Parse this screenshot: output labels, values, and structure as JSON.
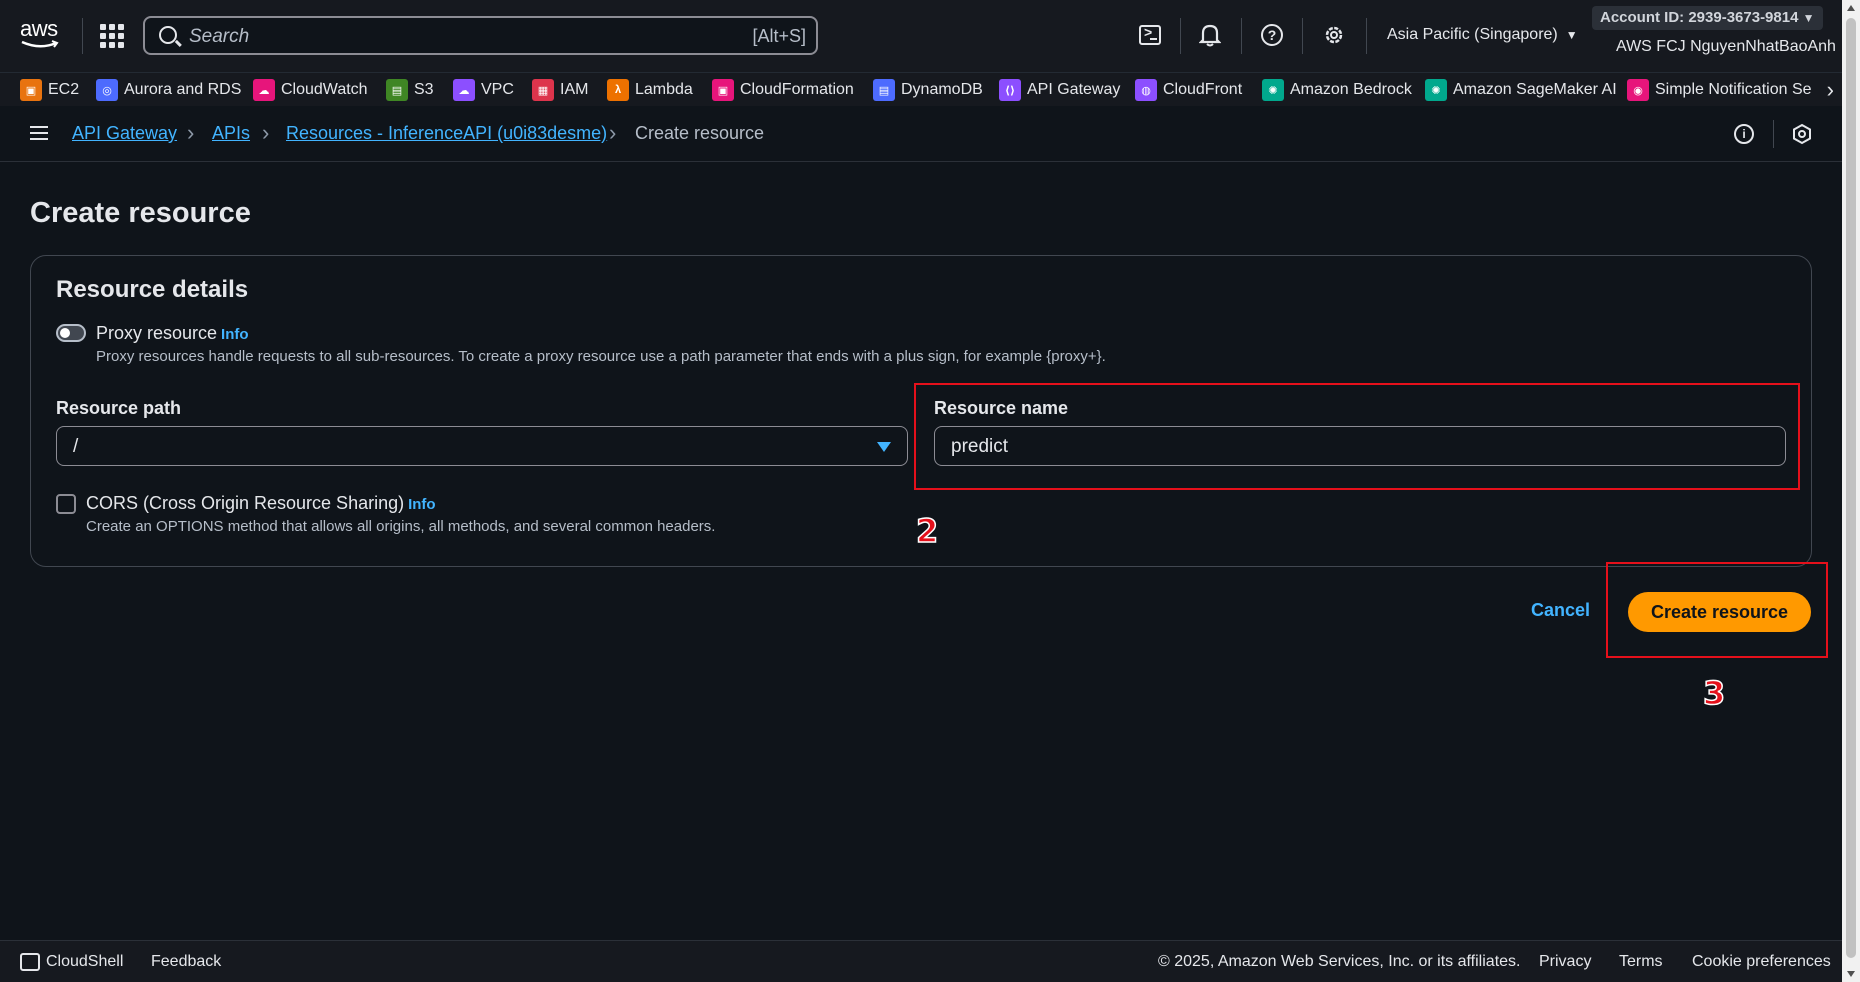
{
  "topbar": {
    "logo_text": "aws",
    "search_placeholder": "Search",
    "search_shortcut": "[Alt+S]",
    "region": "Asia Pacific (Singapore)",
    "account_id": "Account ID: 2939-3673-9814",
    "account_user": "AWS FCJ NguyenNhatBaoAnh"
  },
  "favorites": [
    {
      "label": "EC2",
      "color": "#e8730f"
    },
    {
      "label": "Aurora and RDS",
      "color": "#4d6bfe"
    },
    {
      "label": "CloudWatch",
      "color": "#e7157b"
    },
    {
      "label": "S3",
      "color": "#3f8624"
    },
    {
      "label": "VPC",
      "color": "#8c4fff"
    },
    {
      "label": "IAM",
      "color": "#dd344c"
    },
    {
      "label": "Lambda",
      "color": "#ed7100"
    },
    {
      "label": "CloudFormation",
      "color": "#e7157b"
    },
    {
      "label": "DynamoDB",
      "color": "#4d6bfe"
    },
    {
      "label": "API Gateway",
      "color": "#8c4fff"
    },
    {
      "label": "CloudFront",
      "color": "#8c4fff"
    },
    {
      "label": "Amazon Bedrock",
      "color": "#01a88d"
    },
    {
      "label": "Amazon SageMaker AI",
      "color": "#01a88d"
    },
    {
      "label": "Simple Notification Se",
      "color": "#e7157b"
    }
  ],
  "breadcrumb": {
    "items": [
      "API Gateway",
      "APIs",
      "Resources - InferenceAPI (u0i83desme)"
    ],
    "current": "Create resource"
  },
  "page": {
    "title": "Create resource",
    "card_title": "Resource details",
    "proxy_label": "Proxy resource",
    "info_text": "Info",
    "proxy_desc": "Proxy resources handle requests to all sub-resources. To create a proxy resource use a path parameter that ends with a plus sign, for example {proxy+}.",
    "resource_path_label": "Resource path",
    "resource_path_value": "/",
    "resource_name_label": "Resource name",
    "resource_name_value": "predict",
    "cors_label": "CORS (Cross Origin Resource Sharing)",
    "cors_desc": "Create an OPTIONS method that allows all origins, all methods, and several common headers.",
    "cancel_label": "Cancel",
    "create_label": "Create resource"
  },
  "annotations": {
    "step2": "2",
    "step3": "3"
  },
  "footer": {
    "cloudshell": "CloudShell",
    "feedback": "Feedback",
    "copyright": "© 2025, Amazon Web Services, Inc. or its affiliates.",
    "privacy": "Privacy",
    "terms": "Terms",
    "cookie": "Cookie preferences"
  },
  "colors": {
    "accent": "#ff9900",
    "link": "#42b4ff",
    "highlight": "#e5101b"
  }
}
